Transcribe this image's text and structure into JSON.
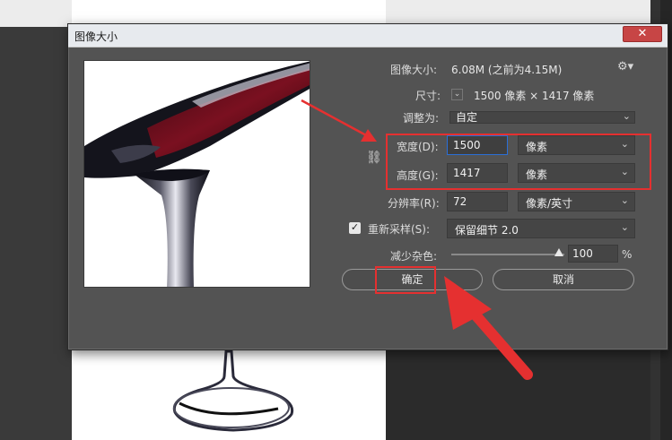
{
  "dialog": {
    "title": "图像大小",
    "close_glyph": "✕",
    "image_size_label": "图像大小:",
    "image_size_value": "6.08M (之前为4.15M)",
    "dimensions_label": "尺寸:",
    "dimensions_value": "1500 像素  ×  1417 像素",
    "fit_to_label": "调整为:",
    "fit_to_value": "自定",
    "width_label": "宽度(D):",
    "width_value": "1500",
    "width_unit": "像素",
    "height_label": "高度(G):",
    "height_value": "1417",
    "height_unit": "像素",
    "resolution_label": "分辨率(R):",
    "resolution_value": "72",
    "resolution_unit": "像素/英寸",
    "resample_label": "重新采样(S):",
    "resample_checked": true,
    "resample_value": "保留细节 2.0",
    "reduce_noise_label": "减少杂色:",
    "reduce_noise_value": "100",
    "reduce_noise_unit": "%",
    "reduce_noise_level": 1.0,
    "ok_label": "确定",
    "cancel_label": "取消"
  },
  "icons": {
    "gear": "gear-icon",
    "link": "chain-link-icon",
    "chevron": "chevron-down-icon",
    "check": "checkmark-icon"
  },
  "colors": {
    "annotation_red": "#e53030",
    "focus_blue": "#2b6ed6",
    "dialog_bg": "#535353"
  }
}
